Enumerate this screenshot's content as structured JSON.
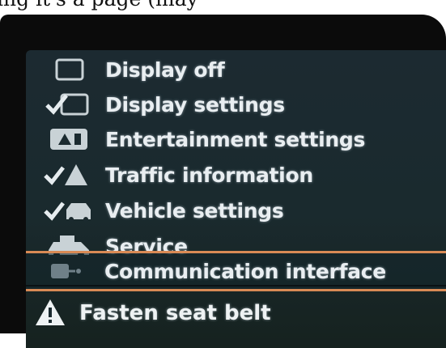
{
  "top_text": "ing it's a page (may",
  "menu": {
    "items": [
      {
        "label": "Display off",
        "icon": "display-off-icon",
        "selected": false
      },
      {
        "label": "Display settings",
        "icon": "display-settings-icon",
        "selected": false
      },
      {
        "label": "Entertainment settings",
        "icon": "entertainment-settings-icon",
        "selected": false
      },
      {
        "label": "Traffic information",
        "icon": "traffic-information-icon",
        "selected": false
      },
      {
        "label": "Vehicle settings",
        "icon": "vehicle-settings-icon",
        "selected": false
      },
      {
        "label": "Service",
        "icon": "service-icon",
        "selected": false
      },
      {
        "label": "Communication interface",
        "icon": "communication-interface-icon",
        "selected": true
      }
    ]
  },
  "alert": {
    "label": "Fasten seat belt",
    "icon": "warning-triangle-icon"
  },
  "colors": {
    "screen_background": "#1b2a2f",
    "text": "#e9eef1",
    "selection_border": "#d98a55"
  }
}
